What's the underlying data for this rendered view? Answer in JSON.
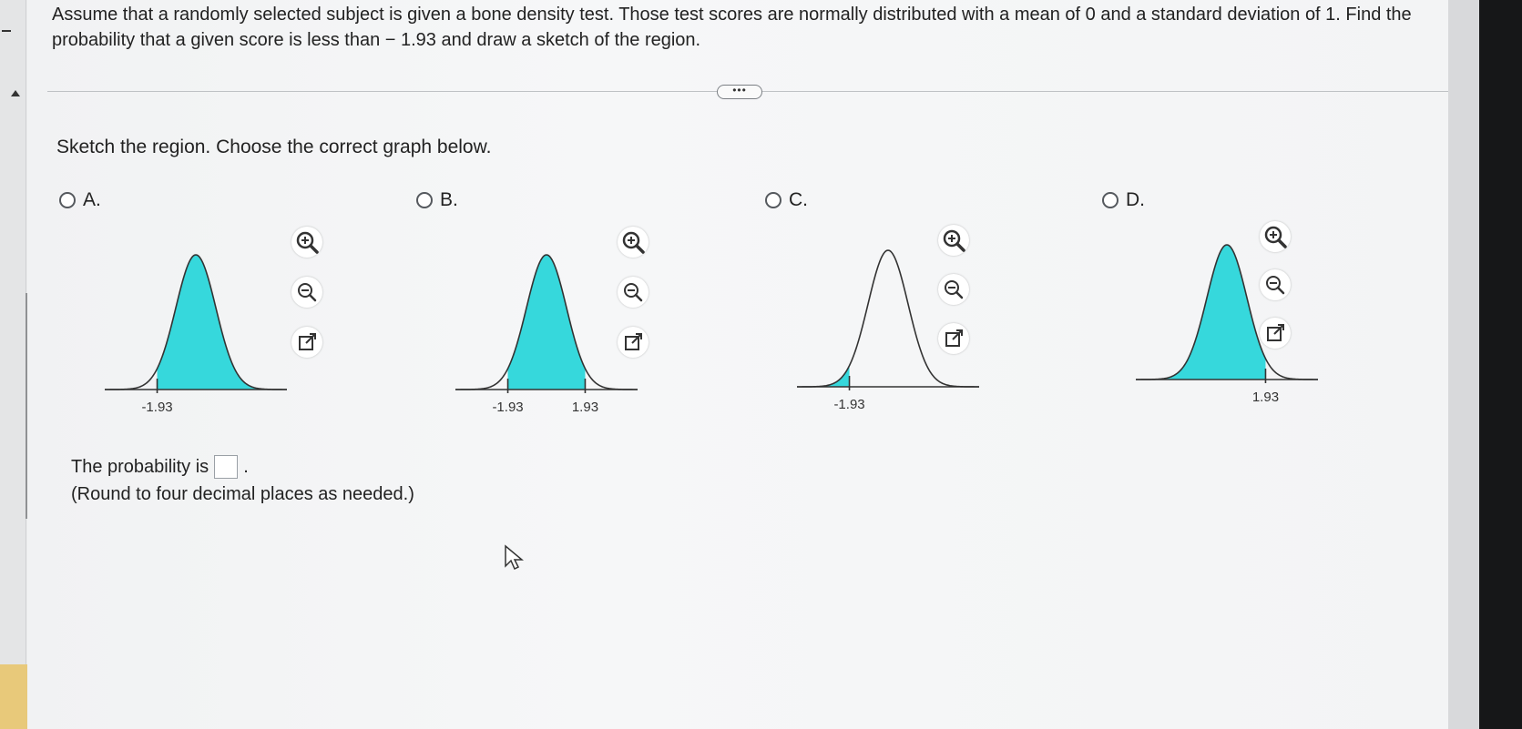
{
  "question": {
    "text": "Assume that a randomly selected subject is given a bone density test. Those test scores are normally distributed with a mean of 0 and a standard deviation of 1. Find the probability that a given score is less than  − 1.93 and draw a sketch of the region."
  },
  "more_button": {
    "label": "•••"
  },
  "instruction": "Sketch the region. Choose the correct graph below.",
  "options": [
    {
      "letter": "A.",
      "shaded": "between_left_and_far_right",
      "labels": [
        "-1.93"
      ]
    },
    {
      "letter": "B.",
      "shaded": "between",
      "labels": [
        "-1.93",
        "1.93"
      ]
    },
    {
      "letter": "C.",
      "shaded": "left_tail",
      "labels": [
        "-1.93"
      ]
    },
    {
      "letter": "D.",
      "shaded": "left_of_right",
      "labels": [
        "1.93"
      ]
    }
  ],
  "tools": [
    "zoom-in-icon",
    "zoom-out-icon",
    "external-link-icon"
  ],
  "answer": {
    "prefix": "The probability is",
    "value": "",
    "suffix": ".",
    "note": "(Round to four decimal places as needed.)"
  },
  "colors": {
    "shade": "#36d8dc",
    "stroke": "#333333",
    "background": "#f4f5f6"
  }
}
